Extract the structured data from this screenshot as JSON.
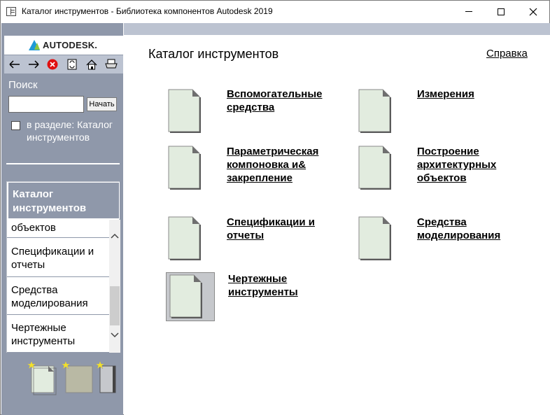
{
  "window": {
    "title": "Каталог инструментов - Библиотека компонентов Autodesk 2019"
  },
  "sidebar": {
    "logo_text": "AUTODESK.",
    "toolbar": [
      {
        "icon": "back-arrow-icon",
        "glyph": "⇦"
      },
      {
        "icon": "forward-arrow-icon",
        "glyph": "⇨"
      },
      {
        "icon": "stop-icon",
        "glyph": "✕"
      },
      {
        "icon": "refresh-icon",
        "glyph": "⟳"
      },
      {
        "icon": "home-icon",
        "glyph": "⌂"
      },
      {
        "icon": "print-icon",
        "glyph": "🖶"
      }
    ],
    "search": {
      "label": "Поиск",
      "value": "",
      "placeholder": "",
      "button_label": "Начать",
      "scope_checked": false,
      "scope_label": "в разделе: Каталог инструментов"
    },
    "nav": {
      "header": "Каталог инструментов",
      "items": [
        {
          "label": "объектов"
        },
        {
          "label": "Спецификации и отчеты"
        },
        {
          "label": "Средства моделирования"
        },
        {
          "label": "Чертежные инструменты"
        }
      ]
    }
  },
  "main": {
    "title": "Каталог инструментов",
    "help_link": "Справка",
    "tools": [
      {
        "label": "Вспомогательные средства"
      },
      {
        "label": "Измерения"
      },
      {
        "label": "Параметрическая компоновка и& закрепление"
      },
      {
        "label": "Построение архитектурных объектов"
      },
      {
        "label": "Спецификации и отчеты"
      },
      {
        "label": "Средства моделирования"
      },
      {
        "label": "Чертежные инструменты"
      }
    ]
  },
  "colors": {
    "sidebar_bg": "#8f98aa",
    "toolbar_bg": "#bcc3d1",
    "tool_icon_fill": "#e2ecdf",
    "stop_icon": "#e01010"
  }
}
